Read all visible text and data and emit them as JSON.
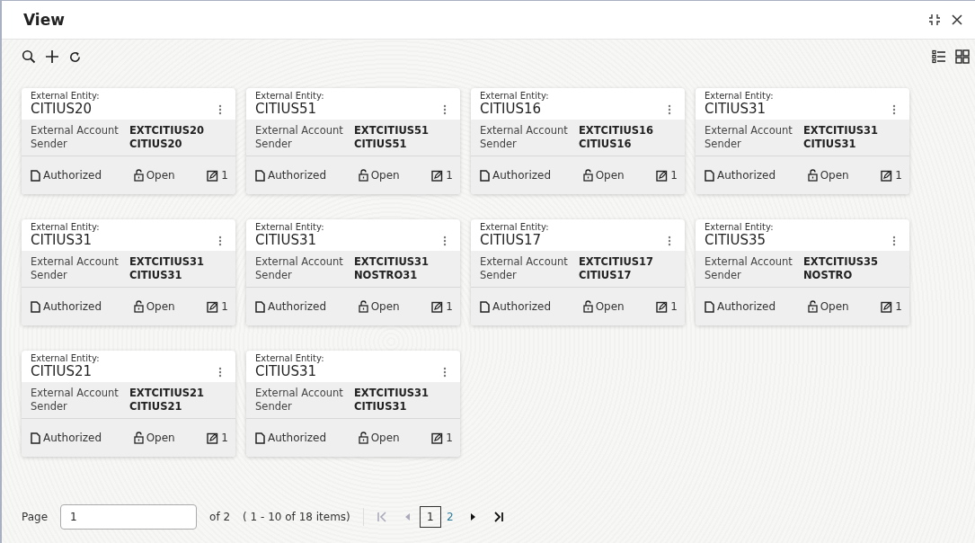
{
  "window": {
    "title": "View"
  },
  "cards": [
    {
      "entity_label": "External Entity:",
      "entity": "CITIUS20",
      "fields": [
        {
          "label": "External Account",
          "value": "EXTCITIUS20"
        },
        {
          "label": "Sender",
          "value": "CITIUS20"
        }
      ],
      "status": "Authorized",
      "lock": "Open",
      "edits": "1"
    },
    {
      "entity_label": "External Entity:",
      "entity": "CITIUS51",
      "fields": [
        {
          "label": "External Account",
          "value": "EXTCITIUS51"
        },
        {
          "label": "Sender",
          "value": "CITIUS51"
        }
      ],
      "status": "Authorized",
      "lock": "Open",
      "edits": "1"
    },
    {
      "entity_label": "External Entity:",
      "entity": "CITIUS16",
      "fields": [
        {
          "label": "External Account",
          "value": "EXTCITIUS16"
        },
        {
          "label": "Sender",
          "value": "CITIUS16"
        }
      ],
      "status": "Authorized",
      "lock": "Open",
      "edits": "1"
    },
    {
      "entity_label": "External Entity:",
      "entity": "CITIUS31",
      "fields": [
        {
          "label": "External Account",
          "value": "EXTCITIUS31"
        },
        {
          "label": "Sender",
          "value": "CITIUS31"
        }
      ],
      "status": "Authorized",
      "lock": "Open",
      "edits": "1"
    },
    {
      "entity_label": "External Entity:",
      "entity": "CITIUS31",
      "fields": [
        {
          "label": "External Account",
          "value": "EXTCITIUS31"
        },
        {
          "label": "Sender",
          "value": "CITIUS31"
        }
      ],
      "status": "Authorized",
      "lock": "Open",
      "edits": "1"
    },
    {
      "entity_label": "External Entity:",
      "entity": "CITIUS31",
      "fields": [
        {
          "label": "External Account",
          "value": "EXTCITIUS31"
        },
        {
          "label": "Sender",
          "value": "NOSTRO31"
        }
      ],
      "status": "Authorized",
      "lock": "Open",
      "edits": "1"
    },
    {
      "entity_label": "External Entity:",
      "entity": "CITIUS17",
      "fields": [
        {
          "label": "External Account",
          "value": "EXTCITIUS17"
        },
        {
          "label": "Sender",
          "value": "CITIUS17"
        }
      ],
      "status": "Authorized",
      "lock": "Open",
      "edits": "1"
    },
    {
      "entity_label": "External Entity:",
      "entity": "CITIUS35",
      "fields": [
        {
          "label": "External Account",
          "value": "EXTCITIUS35"
        },
        {
          "label": "Sender",
          "value": "NOSTRO"
        }
      ],
      "status": "Authorized",
      "lock": "Open",
      "edits": "1"
    },
    {
      "entity_label": "External Entity:",
      "entity": "CITIUS21",
      "fields": [
        {
          "label": "External Account",
          "value": "EXTCITIUS21"
        },
        {
          "label": "Sender",
          "value": "CITIUS21"
        }
      ],
      "status": "Authorized",
      "lock": "Open",
      "edits": "1"
    },
    {
      "entity_label": "External Entity:",
      "entity": "CITIUS31",
      "fields": [
        {
          "label": "External Account",
          "value": "EXTCITIUS31"
        },
        {
          "label": "Sender",
          "value": "CITIUS31"
        }
      ],
      "status": "Authorized",
      "lock": "Open",
      "edits": "1"
    }
  ],
  "pagination": {
    "label": "Page",
    "value": "1",
    "of": "of 2",
    "range": "( 1 - 10 of 18 items)",
    "nav": [
      {
        "kind": "first",
        "disabled": true
      },
      {
        "kind": "prev",
        "disabled": true
      },
      {
        "kind": "next",
        "disabled": false
      },
      {
        "kind": "last",
        "disabled": false
      }
    ],
    "pages": [
      {
        "label": "1",
        "selected": true
      },
      {
        "label": "2",
        "selected": false
      }
    ]
  }
}
